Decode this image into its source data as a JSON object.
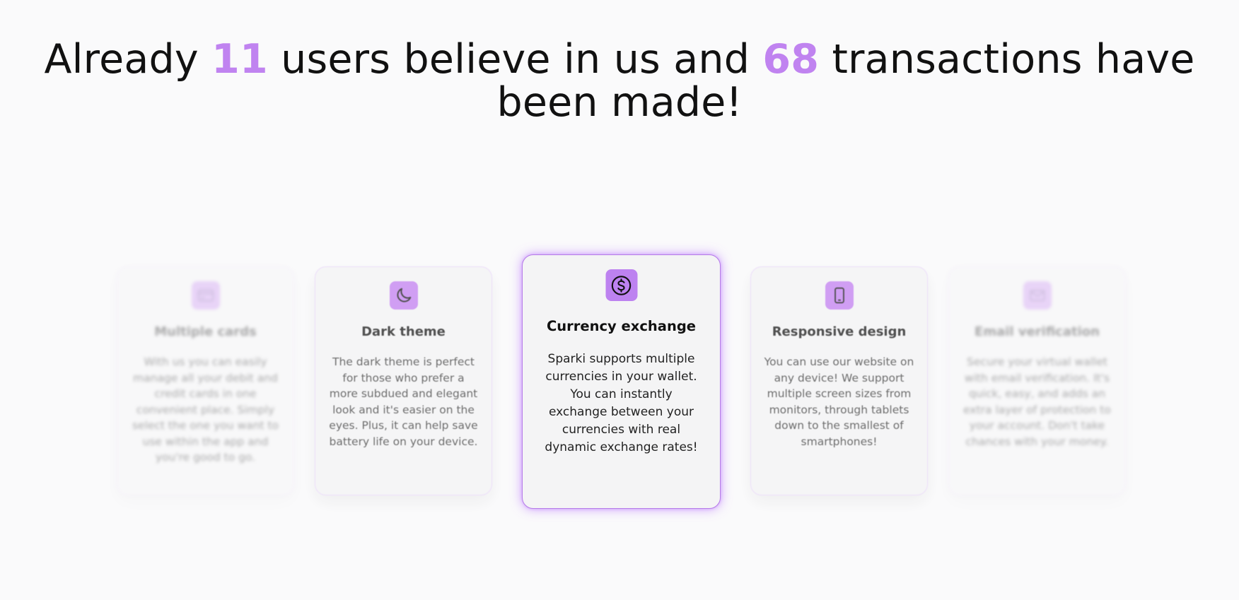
{
  "headline": {
    "part1": "Already ",
    "users_count": "11",
    "part2": " users believe in us and ",
    "transactions_count": "68",
    "part3": " transactions have been made!"
  },
  "features": [
    {
      "title": "Multiple cards",
      "icon": "credit-card-icon",
      "description": "With us you can easily manage all your debit and credit cards in one convenient place. Simply select the one you want to use within the app and you're good to go."
    },
    {
      "title": "Dark theme",
      "icon": "moon-icon",
      "description": "The dark theme is perfect for those who prefer a more subdued and elegant look and it's easier on the eyes. Plus, it can help save battery life on your device."
    },
    {
      "title": "Currency exchange",
      "icon": "dollar-coin-icon",
      "description": "Sparki supports multiple currencies in your wallet. You can instantly exchange between your currencies with real dynamic exchange rates!"
    },
    {
      "title": "Responsive design",
      "icon": "smartphone-icon",
      "description": "You can use our website on any device! We support multiple screen sizes from monitors, through tablets down to the smallest of smartphones!"
    },
    {
      "title": "Email verification",
      "icon": "envelope-icon",
      "description": "Secure your virtual wallet with email verification. It's quick, easy, and adds an extra layer of protection to your account. Don't take chances with your money."
    }
  ],
  "colors": {
    "accent": "#c083f0",
    "card_border": "#ead9fa",
    "active_border": "#b57be8"
  }
}
